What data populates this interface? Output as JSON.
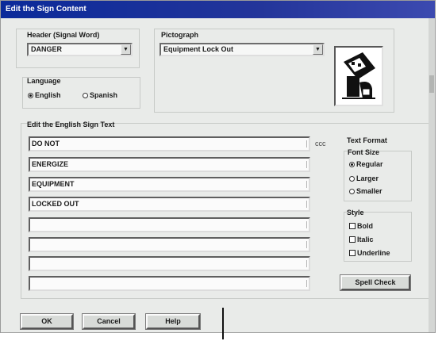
{
  "window": {
    "title": "Edit the Sign Content"
  },
  "header_group": {
    "label": "Header (Signal Word)",
    "selected": "DANGER"
  },
  "pictograph_group": {
    "label": "Pictograph",
    "selected": "Equipment Lock Out",
    "image_icon": "lockout-pictograph-icon"
  },
  "language_group": {
    "label": "Language",
    "options": [
      {
        "label": "English",
        "selected": true
      },
      {
        "label": "Spanish",
        "selected": false
      }
    ]
  },
  "sign_text": {
    "label": "Edit the English Sign Text",
    "lines": [
      "DO NOT",
      "ENERGIZE",
      "EQUIPMENT",
      "LOCKED OUT",
      "",
      "",
      "",
      ""
    ],
    "line_hint": "ccc"
  },
  "text_format": {
    "label": "Text Format",
    "font_size": {
      "label": "Font Size",
      "options": [
        {
          "label": "Regular",
          "selected": true
        },
        {
          "label": "Larger",
          "selected": false
        },
        {
          "label": "Smaller",
          "selected": false
        }
      ]
    },
    "style": {
      "label": "Style",
      "options": [
        {
          "label": "Bold",
          "checked": false
        },
        {
          "label": "Italic",
          "checked": false
        },
        {
          "label": "Underline",
          "checked": false
        }
      ]
    }
  },
  "buttons": {
    "spell_check": "Spell Check",
    "ok": "OK",
    "cancel": "Cancel",
    "help": "Help"
  },
  "colors": {
    "title_bar": "#0b2a9a",
    "dialog_bg": "#e9ebe9"
  }
}
